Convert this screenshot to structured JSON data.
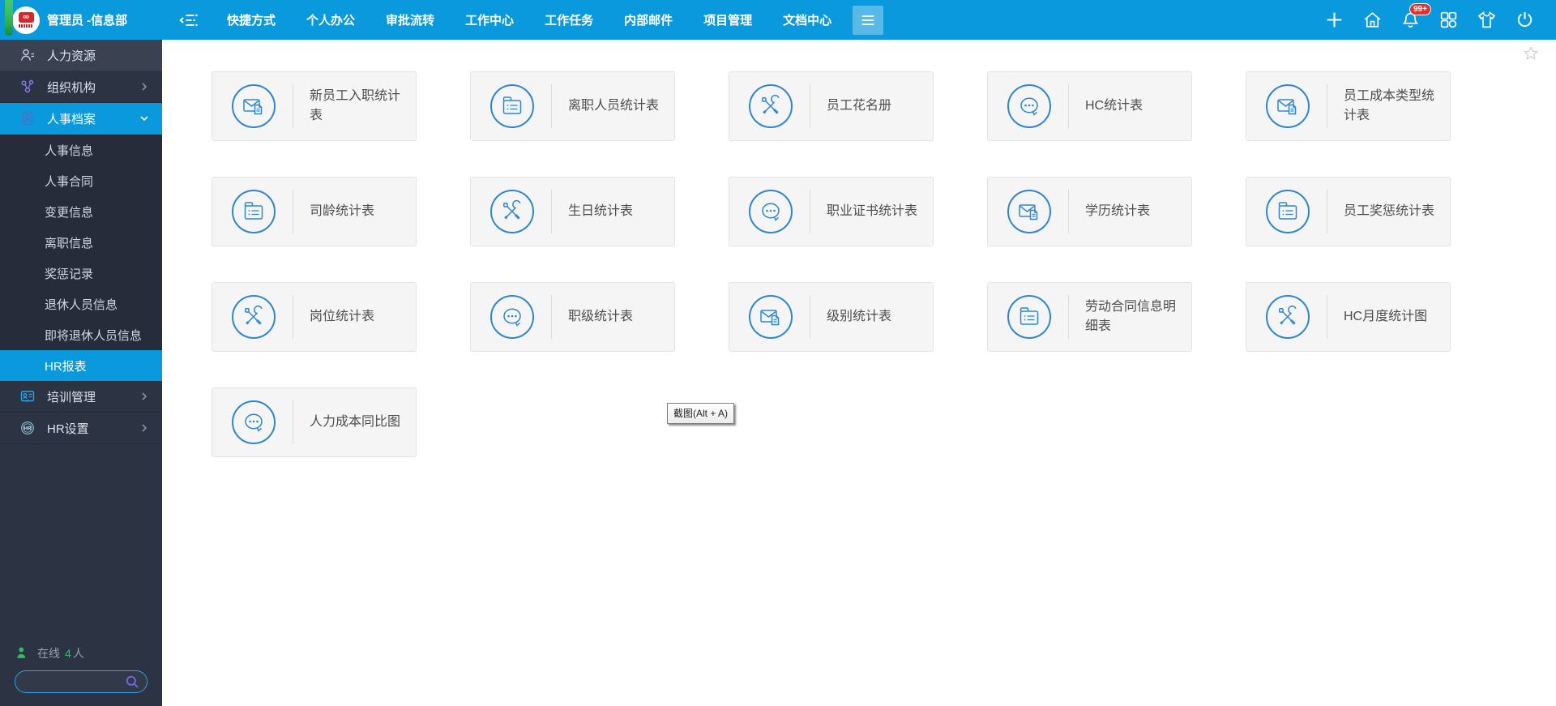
{
  "topbar": {
    "title": "管理员 -信息部",
    "nav_items": [
      "快捷方式",
      "个人办公",
      "审批流转",
      "工作中心",
      "工作任务",
      "内部邮件",
      "项目管理",
      "文档中心"
    ],
    "notification_badge": "99+",
    "accent_color": "#0A99DC"
  },
  "sidebar": {
    "items": [
      {
        "label": "人力资源"
      },
      {
        "label": "组织机构"
      },
      {
        "label": "人事档案"
      }
    ],
    "submenu": [
      {
        "label": "人事信息"
      },
      {
        "label": "人事合同"
      },
      {
        "label": "变更信息"
      },
      {
        "label": "离职信息"
      },
      {
        "label": "奖惩记录"
      },
      {
        "label": "退休人员信息"
      },
      {
        "label": "即将退休人员信息"
      },
      {
        "label": "HR报表",
        "active": true
      }
    ],
    "groups": [
      {
        "label": "培训管理"
      },
      {
        "label": "HR设置"
      }
    ],
    "online": {
      "label": "在线",
      "count": "4",
      "unit": "人"
    },
    "search": {
      "value": "",
      "placeholder": ""
    },
    "colors": {
      "bg": "#2C3343",
      "submenu_bg": "#262C3A",
      "active": "#0999DC",
      "online_green": "#2FBE5F"
    }
  },
  "content": {
    "cards": [
      {
        "label": "新员工入职统计表",
        "icon": "mail-doc"
      },
      {
        "label": "离职人员统计表",
        "icon": "folder-list"
      },
      {
        "label": "员工花名册",
        "icon": "tools"
      },
      {
        "label": "HC统计表",
        "icon": "chat"
      },
      {
        "label": "员工成本类型统计表",
        "icon": "mail-doc"
      },
      {
        "label": "司龄统计表",
        "icon": "folder-list"
      },
      {
        "label": "生日统计表",
        "icon": "tools"
      },
      {
        "label": "职业证书统计表",
        "icon": "chat"
      },
      {
        "label": "学历统计表",
        "icon": "mail-doc"
      },
      {
        "label": "员工奖惩统计表",
        "icon": "folder-list"
      },
      {
        "label": "岗位统计表",
        "icon": "tools"
      },
      {
        "label": "职级统计表",
        "icon": "chat"
      },
      {
        "label": "级别统计表",
        "icon": "mail-doc"
      },
      {
        "label": "劳动合同信息明细表",
        "icon": "folder-list"
      },
      {
        "label": "HC月度统计图",
        "icon": "tools"
      },
      {
        "label": "人力成本同比图",
        "icon": "chat"
      }
    ],
    "card_icon_color": "#2E86D2"
  },
  "tooltip": {
    "text": "截图(Alt + A)"
  }
}
